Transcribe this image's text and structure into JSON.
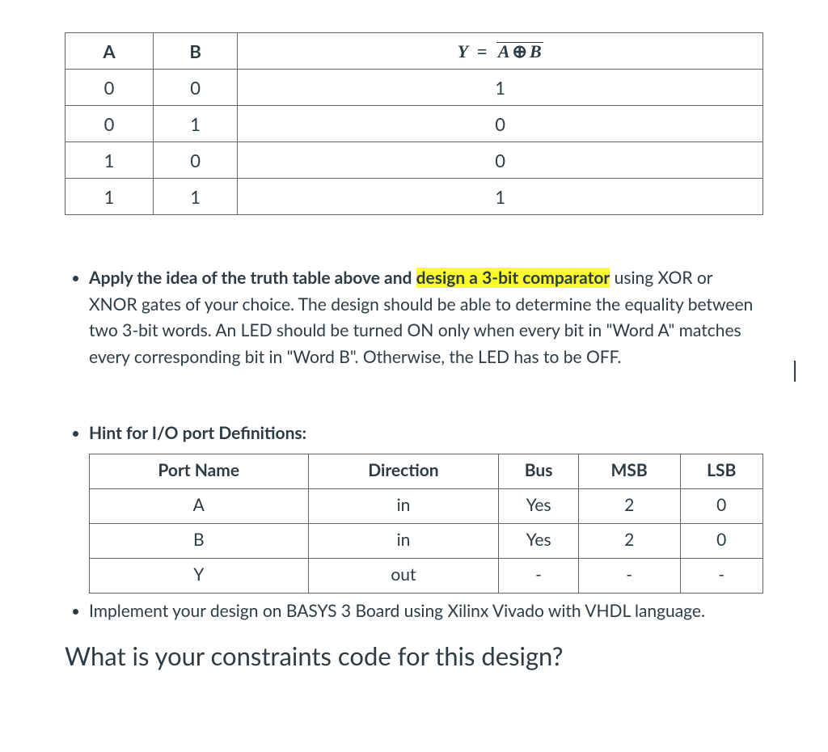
{
  "truth_table": {
    "headers": {
      "a": "A",
      "b": "B",
      "y_var": "Y",
      "eq": "=",
      "over_a": "A",
      "over_op": "⊕",
      "over_b": "B"
    },
    "rows": [
      {
        "a": "0",
        "b": "0",
        "y": "1"
      },
      {
        "a": "0",
        "b": "1",
        "y": "0"
      },
      {
        "a": "1",
        "b": "0",
        "y": "0"
      },
      {
        "a": "1",
        "b": "1",
        "y": "1"
      }
    ]
  },
  "bullets": {
    "b1_pre": "Apply the idea of the truth table above and ",
    "b1_hl": "design a 3-bit comparator",
    "b1_post": " using XOR or XNOR gates of your choice. The design should be able to determine the equality between two 3-bit words. An LED should be turned ON only when every bit in \"Word A\" matches every corresponding bit in \"Word B\". Otherwise, the LED has to be OFF.",
    "b2_title": "Hint for I/O port Definitions:",
    "b3_text": "Implement your design on BASYS 3 Board using Xilinx Vivado with VHDL language."
  },
  "port_table": {
    "headers": [
      "Port Name",
      "Direction",
      "Bus",
      "MSB",
      "LSB"
    ],
    "rows": [
      [
        "A",
        "in",
        "Yes",
        "2",
        "0"
      ],
      [
        "B",
        "in",
        "Yes",
        "2",
        "0"
      ],
      [
        "Y",
        "out",
        "-",
        "-",
        "-"
      ]
    ]
  },
  "question": "What is your constraints code for this design?"
}
